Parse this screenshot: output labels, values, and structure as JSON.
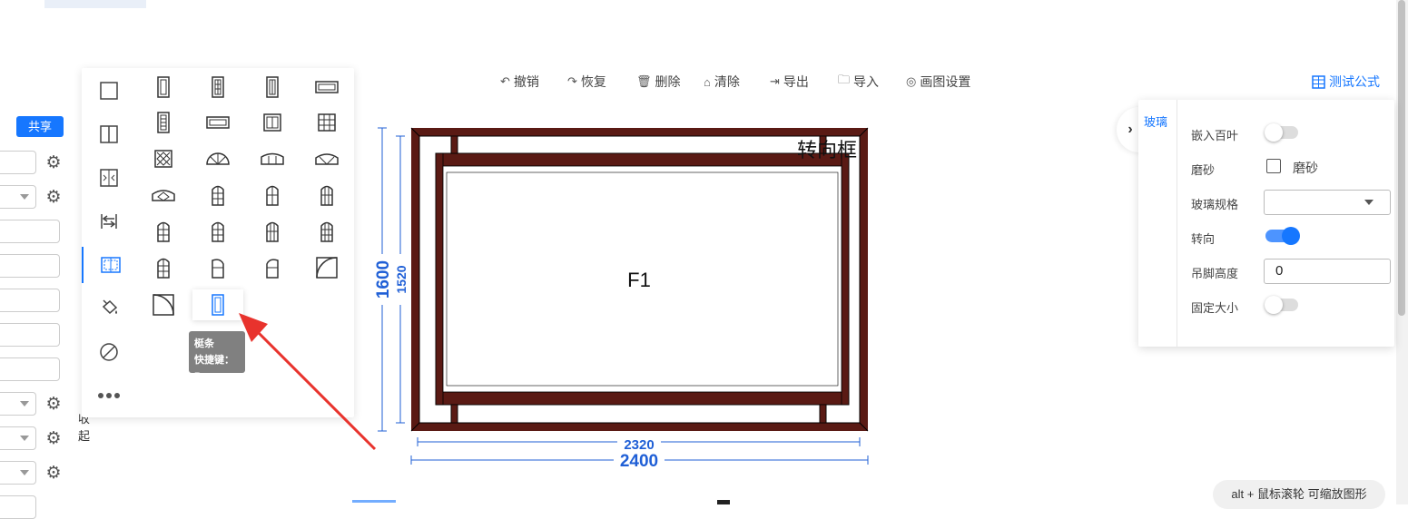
{
  "left_panel": {
    "share_label": "共享",
    "collapse_text_1": "收",
    "collapse_text_2": "起"
  },
  "palette": {
    "categories": [
      "square-icon",
      "two-pane-icon",
      "sash-icon",
      "swap-icon",
      "mullion-icon",
      "paint-bucket-icon",
      "forbidden-icon",
      "more-icon"
    ],
    "active_category": 4,
    "tooltip_title": "梃条",
    "tooltip_shortcut": "快捷键：B"
  },
  "toolbar": {
    "undo": "撤销",
    "redo": "恢复",
    "delete": "删除",
    "clear": "清除",
    "export": "导出",
    "import": "导入",
    "settings": "画图设置",
    "test_formula": "测试公式"
  },
  "drawing": {
    "label_center": "F1",
    "label_corner": "转向框",
    "dim_outer_width": "2400",
    "dim_inner_width": "2320",
    "dim_outer_height": "1600",
    "dim_inner_height": "1520",
    "frame_color": "#5a1a14",
    "dim_color": "#1f5fd6"
  },
  "right_panel": {
    "tab_label": "玻璃",
    "rows": {
      "louver": "嵌入百叶",
      "frosted": "磨砂",
      "frosted_checkbox": "磨砂",
      "glass_spec": "玻璃规格",
      "rotate": "转向",
      "hang_height": "吊脚高度",
      "fixed_size": "固定大小"
    },
    "hang_height_value": "0"
  },
  "hint": "alt + 鼠标滚轮 可缩放图形",
  "accent_color": "#1677ff"
}
